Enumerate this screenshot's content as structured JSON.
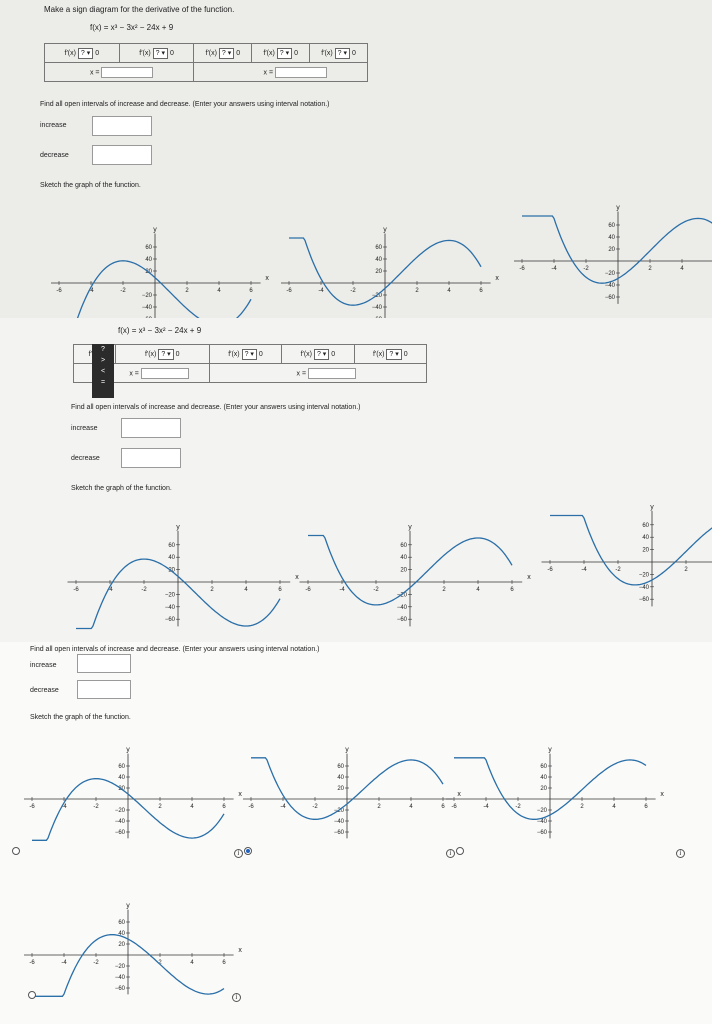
{
  "instruction": "Make a sign diagram for the derivative of the function.",
  "function_text": "f(x) = x³ − 3x² − 24x + 9",
  "sign_cells": [
    "f′(x)",
    "f′(x)",
    "f′(x)",
    "f′(x)",
    "f′(x)"
  ],
  "select_placeholder": "?",
  "zero": "0",
  "x_equals": "x =",
  "intervals_prompt": "Find all open intervals of increase and decrease. (Enter your answers using interval notation.)",
  "increase_label": "increase",
  "decrease_label": "decrease",
  "sketch_prompt": "Sketch the graph of the function.",
  "dropdown_menu": [
    "?",
    ">",
    "<",
    "="
  ],
  "graph": {
    "x_ticks": [
      "-6",
      "-4",
      "-2",
      "2",
      "4",
      "6"
    ],
    "y_ticks": [
      "60",
      "40",
      "20",
      "20",
      "40",
      "60"
    ],
    "x_label": "x",
    "y_label": "y"
  },
  "icons": {
    "info": "i"
  },
  "radio_selected": 1
}
